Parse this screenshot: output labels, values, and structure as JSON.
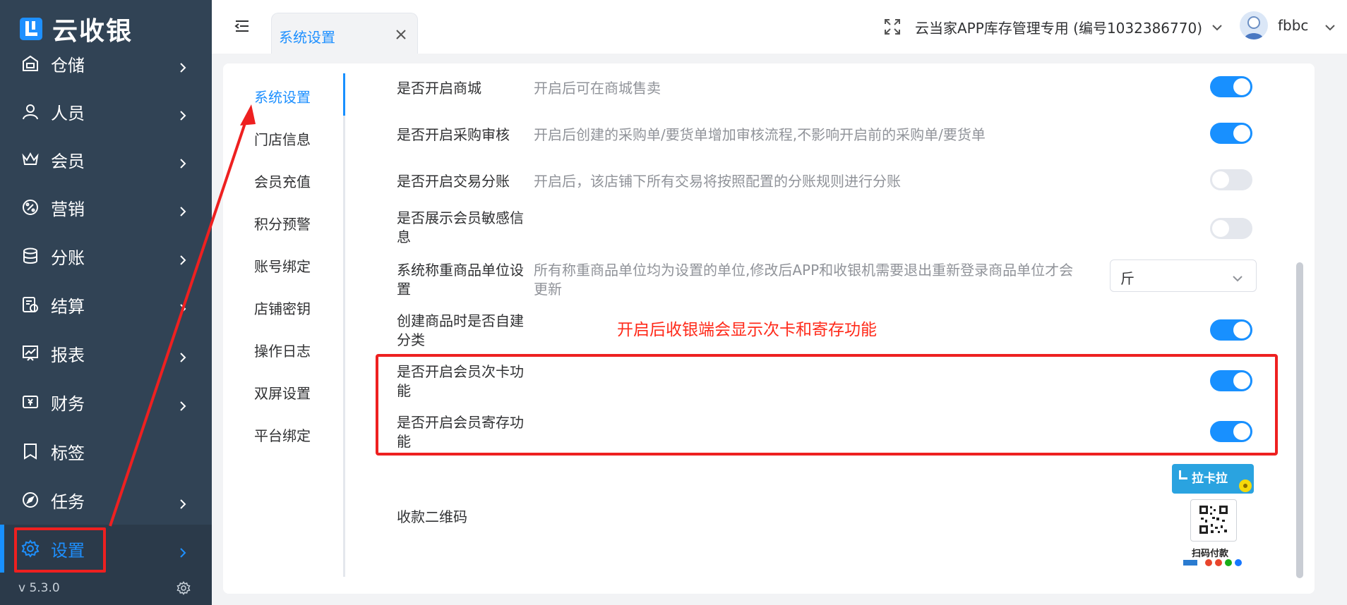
{
  "app": {
    "name": "云收银",
    "version": "v 5.3.0"
  },
  "sidebar": {
    "items": [
      {
        "label": "仓储",
        "icon": "warehouse-icon"
      },
      {
        "label": "人员",
        "icon": "person-icon"
      },
      {
        "label": "会员",
        "icon": "crown-icon"
      },
      {
        "label": "营销",
        "icon": "marketing-icon"
      },
      {
        "label": "分账",
        "icon": "database-icon"
      },
      {
        "label": "结算",
        "icon": "settlement-icon"
      },
      {
        "label": "报表",
        "icon": "chart-icon"
      },
      {
        "label": "财务",
        "icon": "wallet-icon"
      },
      {
        "label": "标签",
        "icon": "tag-icon"
      },
      {
        "label": "任务",
        "icon": "compass-icon"
      },
      {
        "label": "设置",
        "icon": "gear-icon",
        "active": true
      }
    ]
  },
  "topbar": {
    "tab_label": "系统设置",
    "store_name": "云当家APP库存管理专用 (编号1032386770)",
    "user_name": "fbbc"
  },
  "subnav": {
    "items": [
      "系统设置",
      "门店信息",
      "会员充值",
      "积分预警",
      "账号绑定",
      "店铺密钥",
      "操作日志",
      "双屏设置",
      "平台绑定"
    ],
    "active_index": 0
  },
  "settings": [
    {
      "label": "是否开启商城",
      "desc": "开启后可在商城售卖",
      "enabled": true
    },
    {
      "label": "是否开启采购审核",
      "desc": "开启后创建的采购单/要货单增加审核流程,不影响开启前的采购单/要货单",
      "enabled": true
    },
    {
      "label": "是否开启交易分账",
      "desc": "开启后，该店铺下所有交易将按照配置的分账规则进行分账",
      "enabled": false
    },
    {
      "label_line1": "是否展示会员敏感信",
      "label_line2": "息",
      "enabled": false
    },
    {
      "label_line1": "系统称重商品单位设",
      "label_line2": "置",
      "desc_line1": "所有称重商品单位均为设置的单位,修改后APP和收银机需要退出重新登录商品单位才会",
      "desc_line2": "更新",
      "unit_value": "斤"
    },
    {
      "label_line1": "创建商品时是否自建",
      "label_line2": "分类",
      "enabled": true
    },
    {
      "label_line1": "是否开启会员次卡功",
      "label_line2": "能",
      "enabled": true
    },
    {
      "label_line1": "是否开启会员寄存功",
      "label_line2": "能",
      "enabled": true
    },
    {
      "label": "收款二维码"
    }
  ],
  "qr": {
    "brand": "拉卡拉",
    "scan_text": "扫码付款"
  },
  "annotation": {
    "note": "开启后收银端会显示次卡和寄存功能",
    "color": "#ff2a1a"
  },
  "colors": {
    "sidebar_bg": "#314355",
    "accent": "#1890ff"
  }
}
